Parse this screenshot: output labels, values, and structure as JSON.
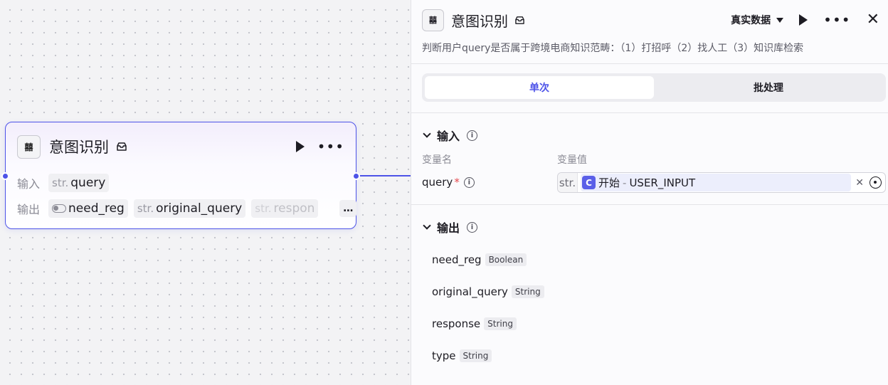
{
  "node": {
    "icon_text": "囍",
    "title": "意图识别",
    "input_label": "输入",
    "input_tag": {
      "type": "str.",
      "name": "query"
    },
    "output_label": "输出",
    "output_tags": [
      {
        "type": "",
        "name": "need_reg"
      },
      {
        "type": "str.",
        "name": "original_query"
      },
      {
        "type": "str.",
        "name": "respon"
      }
    ],
    "more": "…"
  },
  "panel": {
    "icon_text": "囍",
    "title": "意图识别",
    "data_select": "真实数据",
    "description": "判断用户query是否属于跨境电商知识范畴：（1）打招呼（2）找人工（3）知识库检索",
    "tabs": [
      {
        "label": "单次",
        "active": true
      },
      {
        "label": "批处理",
        "active": false
      }
    ],
    "input_section": {
      "title": "输入",
      "col_name": "变量名",
      "col_value": "变量值",
      "var_name": "query",
      "required_mark": "*",
      "value_type": "str.",
      "ref_node": "开始",
      "ref_sep": "-",
      "ref_var": "USER_INPUT"
    },
    "output_section": {
      "title": "输出",
      "items": [
        {
          "name": "need_reg",
          "type": "Boolean"
        },
        {
          "name": "original_query",
          "type": "String"
        },
        {
          "name": "response",
          "type": "String"
        },
        {
          "name": "type",
          "type": "String"
        }
      ]
    }
  },
  "colors": {
    "accent": "#4d53e8",
    "required": "#e5484d"
  }
}
